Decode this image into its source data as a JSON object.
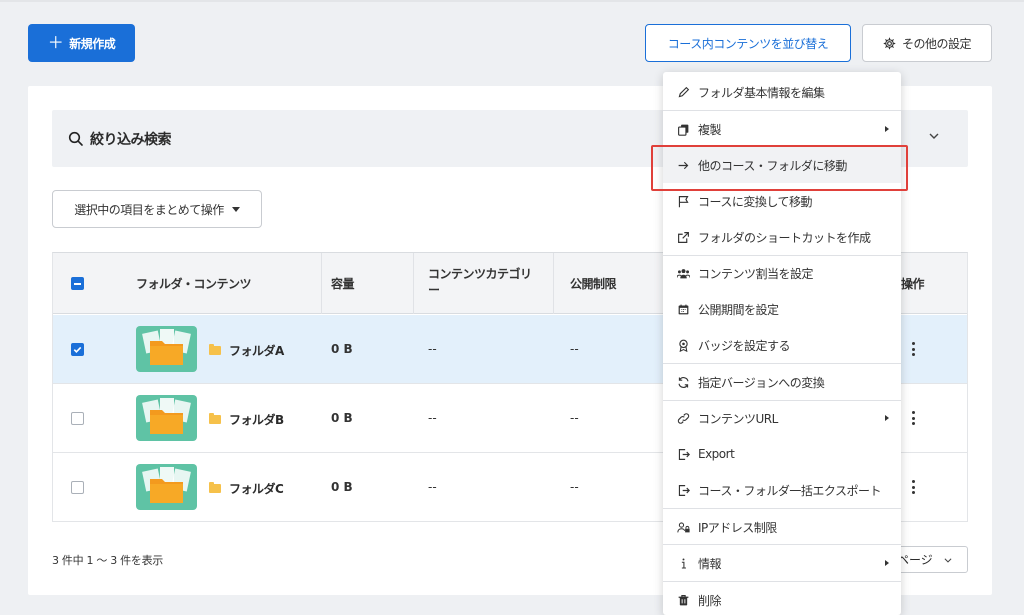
{
  "toolbar": {
    "new_label": "新規作成",
    "reorder_label": "コース内コンテンツを並び替え",
    "settings_label": "その他の設定"
  },
  "filter": {
    "label": "絞り込み検索"
  },
  "bulk_action": {
    "label": "選択中の項目をまとめて操作"
  },
  "table": {
    "headers": {
      "name": "フォルダ・コンテンツ",
      "size": "容量",
      "category_line1": "コンテンツカテゴリ",
      "category_line2": "ー",
      "restriction": "公開制限",
      "actions": "操作"
    },
    "rows": [
      {
        "name": "フォルダA",
        "size": "0 B",
        "category": "--",
        "restriction": "--",
        "checked": true
      },
      {
        "name": "フォルダB",
        "size": "0 B",
        "category": "--",
        "restriction": "--",
        "checked": false
      },
      {
        "name": "フォルダC",
        "size": "0 B",
        "category": "--",
        "restriction": "--",
        "checked": false
      }
    ]
  },
  "pagination": {
    "info": "3 件中 1 ～ 3 件を表示",
    "per_page_label": "ページ"
  },
  "menu": {
    "items": [
      {
        "label": "フォルダ基本情報を編集",
        "icon": "pencil-icon"
      },
      {
        "label": "複製",
        "icon": "copy-icon",
        "submenu": true
      },
      {
        "label": "他のコース・フォルダに移動",
        "icon": "arrow-right-icon",
        "highlighted": true
      },
      {
        "label": "コースに変換して移動",
        "icon": "flag-icon"
      },
      {
        "label": "フォルダのショートカットを作成",
        "icon": "external-link-icon"
      },
      {
        "label": "コンテンツ割当を設定",
        "icon": "users-icon"
      },
      {
        "label": "公開期間を設定",
        "icon": "calendar-icon"
      },
      {
        "label": "バッジを設定する",
        "icon": "badge-icon"
      },
      {
        "label": "指定バージョンへの変換",
        "icon": "refresh-icon"
      },
      {
        "label": "コンテンツURL",
        "icon": "link-icon",
        "submenu": true
      },
      {
        "label": "Export",
        "icon": "export-icon"
      },
      {
        "label": "コース・フォルダ一括エクスポート",
        "icon": "bulk-export-icon"
      },
      {
        "label": "IPアドレス制限",
        "icon": "user-lock-icon"
      },
      {
        "label": "情報",
        "icon": "info-icon",
        "submenu": true
      },
      {
        "label": "削除",
        "icon": "trash-icon"
      }
    ]
  },
  "colors": {
    "primary": "#1a6fd8",
    "highlight": "#e0403a",
    "selected_row": "#e3f0fb",
    "thumb_bg": "#5fc3a5",
    "folder": "#f6c14a"
  }
}
